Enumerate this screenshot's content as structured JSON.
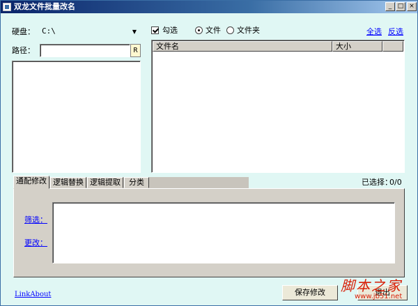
{
  "window": {
    "title": "双龙文件批量改名",
    "controls": [
      "_",
      "□",
      "×"
    ]
  },
  "left": {
    "drive_label": "硬盘：",
    "drive_value": "C:\\",
    "path_label": "路径：",
    "path_value": "",
    "path_button": "R"
  },
  "filters": {
    "check_label": "勾选",
    "radio_file": "文件",
    "radio_folder": "文件夹",
    "select_all": "全选",
    "invert": "反选"
  },
  "list": {
    "columns": [
      "文件名",
      "大小"
    ],
    "selected_label": "已选择：",
    "selected_value": "0/0"
  },
  "tabs": [
    "通配修改",
    "逻辑替换",
    "逻辑提取",
    "分类"
  ],
  "panel": {
    "filter_link": "筛选：",
    "change_link": "更改："
  },
  "footer": {
    "link_about": "LinkAbout",
    "save_button": "保存修改",
    "exit_button": "退出"
  },
  "watermark": {
    "text": "脚本之家",
    "url": "www.jb51.net"
  },
  "colors": {
    "window_bg": "#e0f7f4",
    "titlebar": "#0a246a",
    "link": "#0000ff",
    "watermark": "#d81e06"
  }
}
